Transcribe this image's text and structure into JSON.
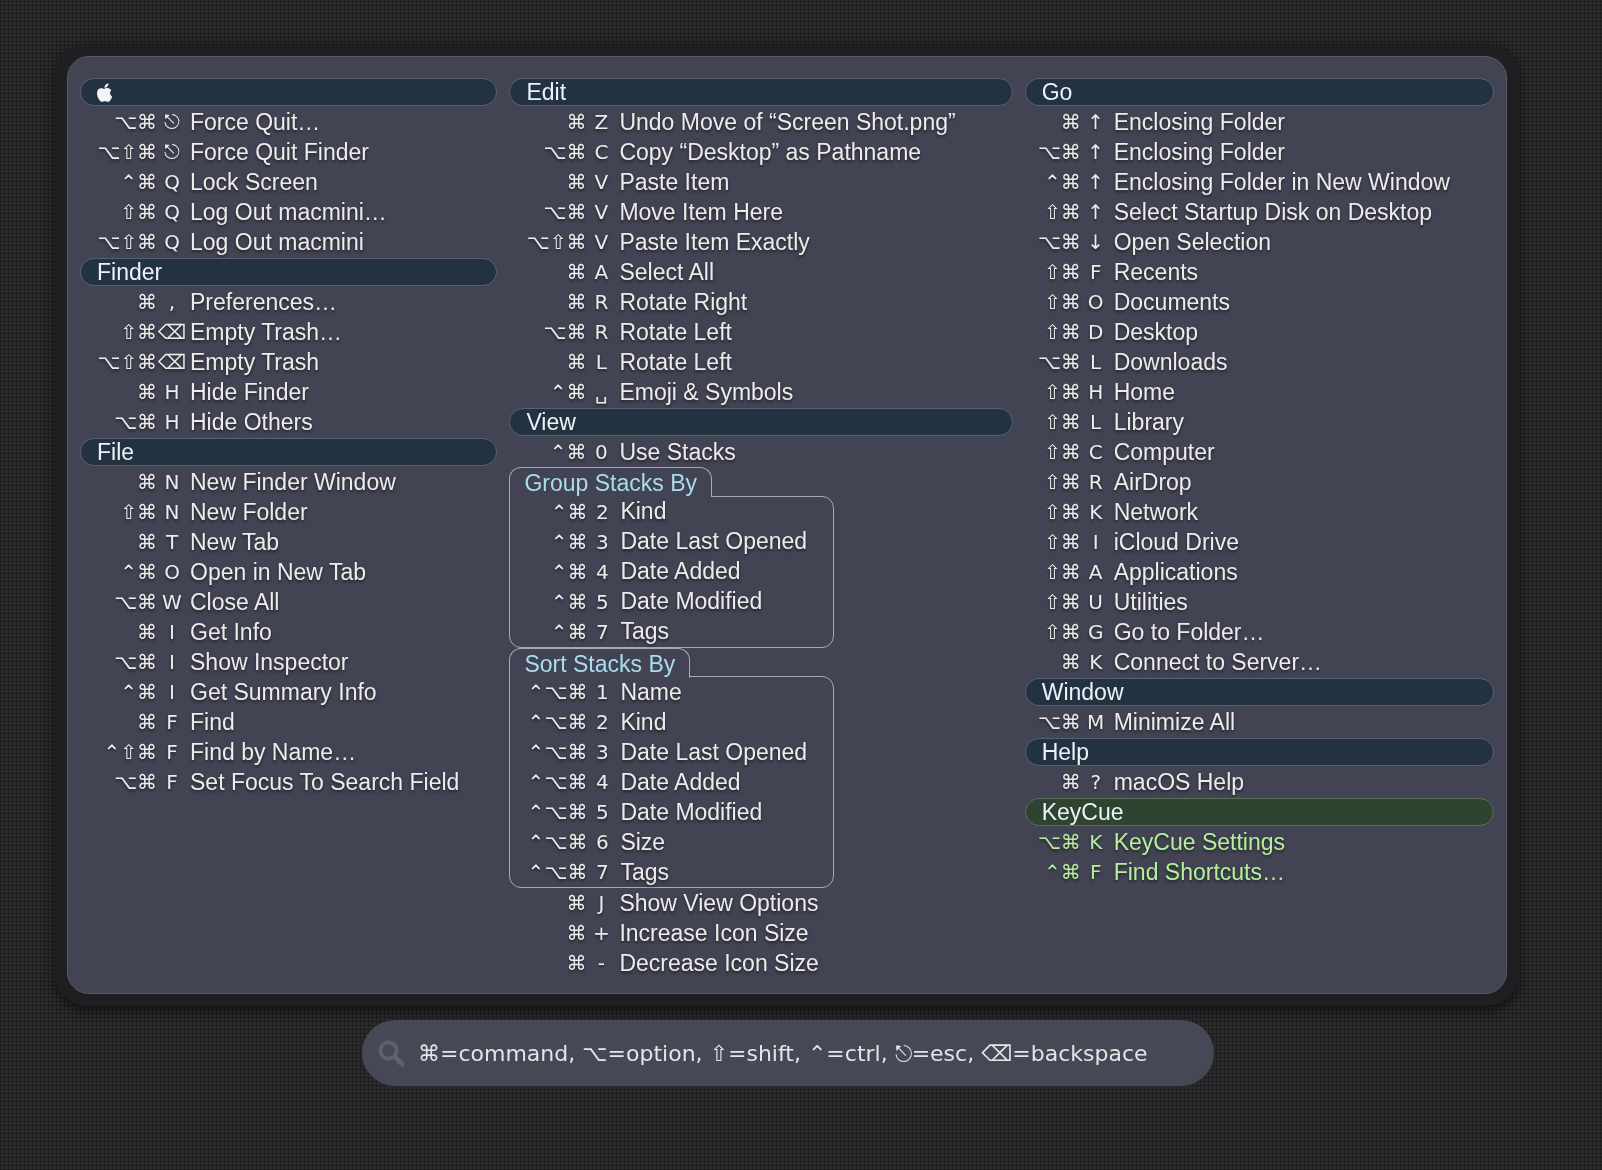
{
  "columns": [
    {
      "sections": [
        {
          "kind": "apple",
          "highlighted": false,
          "items": [
            {
              "kind": "shortcut",
              "mods": "⌥⌘",
              "key": "⎋",
              "label": "Force Quit…"
            },
            {
              "kind": "shortcut",
              "mods": "⌥⇧⌘",
              "key": "⎋",
              "label": "Force Quit Finder"
            },
            {
              "kind": "shortcut",
              "mods": "⌃⌘",
              "key": "Q",
              "label": "Lock Screen"
            },
            {
              "kind": "shortcut",
              "mods": "⇧⌘",
              "key": "Q",
              "label": "Log Out macmini…"
            },
            {
              "kind": "shortcut",
              "mods": "⌥⇧⌘",
              "key": "Q",
              "label": "Log Out macmini"
            }
          ]
        },
        {
          "kind": "menu",
          "title": "Finder",
          "highlighted": false,
          "items": [
            {
              "kind": "shortcut",
              "mods": "⌘",
              "key": ",",
              "label": "Preferences…"
            },
            {
              "kind": "shortcut",
              "mods": "⇧⌘",
              "key": "⌫",
              "label": "Empty Trash…"
            },
            {
              "kind": "shortcut",
              "mods": "⌥⇧⌘",
              "key": "⌫",
              "label": "Empty Trash"
            },
            {
              "kind": "shortcut",
              "mods": "⌘",
              "key": "H",
              "label": "Hide Finder"
            },
            {
              "kind": "shortcut",
              "mods": "⌥⌘",
              "key": "H",
              "label": "Hide Others"
            }
          ]
        },
        {
          "kind": "menu",
          "title": "File",
          "highlighted": false,
          "items": [
            {
              "kind": "shortcut",
              "mods": "⌘",
              "key": "N",
              "label": "New Finder Window"
            },
            {
              "kind": "shortcut",
              "mods": "⇧⌘",
              "key": "N",
              "label": "New Folder"
            },
            {
              "kind": "shortcut",
              "mods": "⌘",
              "key": "T",
              "label": "New Tab"
            },
            {
              "kind": "shortcut",
              "mods": "⌃⌘",
              "key": "O",
              "label": "Open in New Tab"
            },
            {
              "kind": "shortcut",
              "mods": "⌥⌘",
              "key": "W",
              "label": "Close All"
            },
            {
              "kind": "shortcut",
              "mods": "⌘",
              "key": "I",
              "label": "Get Info"
            },
            {
              "kind": "shortcut",
              "mods": "⌥⌘",
              "key": "I",
              "label": "Show Inspector"
            },
            {
              "kind": "shortcut",
              "mods": "⌃⌘",
              "key": "I",
              "label": "Get Summary Info"
            },
            {
              "kind": "shortcut",
              "mods": "⌘",
              "key": "F",
              "label": "Find"
            },
            {
              "kind": "shortcut",
              "mods": "⌃⇧⌘",
              "key": "F",
              "label": "Find by Name…"
            },
            {
              "kind": "shortcut",
              "mods": "⌥⌘",
              "key": "F",
              "label": "Set Focus To Search Field"
            }
          ]
        }
      ]
    },
    {
      "sections": [
        {
          "kind": "menu",
          "title": "Edit",
          "highlighted": false,
          "items": [
            {
              "kind": "shortcut",
              "mods": "⌘",
              "key": "Z",
              "label": "Undo Move of “Screen Shot.png”"
            },
            {
              "kind": "shortcut",
              "mods": "⌥⌘",
              "key": "C",
              "label": "Copy “Desktop” as Pathname"
            },
            {
              "kind": "shortcut",
              "mods": "⌘",
              "key": "V",
              "label": "Paste Item"
            },
            {
              "kind": "shortcut",
              "mods": "⌥⌘",
              "key": "V",
              "label": "Move Item Here"
            },
            {
              "kind": "shortcut",
              "mods": "⌥⇧⌘",
              "key": "V",
              "label": "Paste Item Exactly"
            },
            {
              "kind": "shortcut",
              "mods": "⌘",
              "key": "A",
              "label": "Select All"
            },
            {
              "kind": "shortcut",
              "mods": "⌘",
              "key": "R",
              "label": "Rotate Right"
            },
            {
              "kind": "shortcut",
              "mods": "⌥⌘",
              "key": "R",
              "label": "Rotate Left"
            },
            {
              "kind": "shortcut",
              "mods": "⌘",
              "key": "L",
              "label": "Rotate Left"
            },
            {
              "kind": "shortcut",
              "mods": "⌃⌘",
              "key": "␣",
              "label": "Emoji & Symbols"
            }
          ]
        },
        {
          "kind": "menu",
          "title": "View",
          "highlighted": false,
          "items": [
            {
              "kind": "shortcut",
              "mods": "⌃⌘",
              "key": "0",
              "label": "Use Stacks"
            },
            {
              "kind": "group",
              "title": "Group Stacks By",
              "items": [
                {
                  "kind": "shortcut",
                  "mods": "⌃⌘",
                  "key": "2",
                  "label": "Kind"
                },
                {
                  "kind": "shortcut",
                  "mods": "⌃⌘",
                  "key": "3",
                  "label": "Date Last Opened"
                },
                {
                  "kind": "shortcut",
                  "mods": "⌃⌘",
                  "key": "4",
                  "label": "Date Added"
                },
                {
                  "kind": "shortcut",
                  "mods": "⌃⌘",
                  "key": "5",
                  "label": "Date Modified"
                },
                {
                  "kind": "shortcut",
                  "mods": "⌃⌘",
                  "key": "7",
                  "label": "Tags"
                }
              ]
            },
            {
              "kind": "group",
              "title": "Sort Stacks By",
              "items": [
                {
                  "kind": "shortcut",
                  "mods": "⌃⌥⌘",
                  "key": "1",
                  "label": "Name"
                },
                {
                  "kind": "shortcut",
                  "mods": "⌃⌥⌘",
                  "key": "2",
                  "label": "Kind"
                },
                {
                  "kind": "shortcut",
                  "mods": "⌃⌥⌘",
                  "key": "3",
                  "label": "Date Last Opened"
                },
                {
                  "kind": "shortcut",
                  "mods": "⌃⌥⌘",
                  "key": "4",
                  "label": "Date Added"
                },
                {
                  "kind": "shortcut",
                  "mods": "⌃⌥⌘",
                  "key": "5",
                  "label": "Date Modified"
                },
                {
                  "kind": "shortcut",
                  "mods": "⌃⌥⌘",
                  "key": "6",
                  "label": "Size"
                },
                {
                  "kind": "shortcut",
                  "mods": "⌃⌥⌘",
                  "key": "7",
                  "label": "Tags"
                }
              ]
            },
            {
              "kind": "shortcut",
              "mods": "⌘",
              "key": "J",
              "label": "Show View Options"
            },
            {
              "kind": "shortcut",
              "mods": "⌘",
              "key": "+",
              "label": "Increase Icon Size"
            },
            {
              "kind": "shortcut",
              "mods": "⌘",
              "key": "-",
              "label": "Decrease Icon Size"
            }
          ]
        }
      ]
    },
    {
      "sections": [
        {
          "kind": "menu",
          "title": "Go",
          "highlighted": false,
          "items": [
            {
              "kind": "shortcut",
              "mods": "⌘",
              "key": "↑",
              "label": "Enclosing Folder"
            },
            {
              "kind": "shortcut",
              "mods": "⌥⌘",
              "key": "↑",
              "label": "Enclosing Folder"
            },
            {
              "kind": "shortcut",
              "mods": "⌃⌘",
              "key": "↑",
              "label": "Enclosing Folder in New Window"
            },
            {
              "kind": "shortcut",
              "mods": "⇧⌘",
              "key": "↑",
              "label": "Select Startup Disk on Desktop"
            },
            {
              "kind": "shortcut",
              "mods": "⌥⌘",
              "key": "↓",
              "label": "Open Selection"
            },
            {
              "kind": "shortcut",
              "mods": "⇧⌘",
              "key": "F",
              "label": "Recents"
            },
            {
              "kind": "shortcut",
              "mods": "⇧⌘",
              "key": "O",
              "label": "Documents"
            },
            {
              "kind": "shortcut",
              "mods": "⇧⌘",
              "key": "D",
              "label": "Desktop"
            },
            {
              "kind": "shortcut",
              "mods": "⌥⌘",
              "key": "L",
              "label": "Downloads"
            },
            {
              "kind": "shortcut",
              "mods": "⇧⌘",
              "key": "H",
              "label": "Home"
            },
            {
              "kind": "shortcut",
              "mods": "⇧⌘",
              "key": "L",
              "label": "Library"
            },
            {
              "kind": "shortcut",
              "mods": "⇧⌘",
              "key": "C",
              "label": "Computer"
            },
            {
              "kind": "shortcut",
              "mods": "⇧⌘",
              "key": "R",
              "label": "AirDrop"
            },
            {
              "kind": "shortcut",
              "mods": "⇧⌘",
              "key": "K",
              "label": "Network"
            },
            {
              "kind": "shortcut",
              "mods": "⇧⌘",
              "key": "I",
              "label": "iCloud Drive"
            },
            {
              "kind": "shortcut",
              "mods": "⇧⌘",
              "key": "A",
              "label": "Applications"
            },
            {
              "kind": "shortcut",
              "mods": "⇧⌘",
              "key": "U",
              "label": "Utilities"
            },
            {
              "kind": "shortcut",
              "mods": "⇧⌘",
              "key": "G",
              "label": "Go to Folder…"
            },
            {
              "kind": "shortcut",
              "mods": "⌘",
              "key": "K",
              "label": "Connect to Server…"
            }
          ]
        },
        {
          "kind": "menu",
          "title": "Window",
          "highlighted": false,
          "items": [
            {
              "kind": "shortcut",
              "mods": "⌥⌘",
              "key": "M",
              "label": "Minimize All"
            }
          ]
        },
        {
          "kind": "menu",
          "title": "Help",
          "highlighted": false,
          "items": [
            {
              "kind": "shortcut",
              "mods": "⌘",
              "key": "?",
              "label": "macOS Help"
            }
          ]
        },
        {
          "kind": "menu",
          "title": "KeyCue",
          "highlighted": true,
          "items": [
            {
              "kind": "shortcut",
              "mods": "⌥⌘",
              "key": "K",
              "label": "KeyCue Settings"
            },
            {
              "kind": "shortcut",
              "mods": "⌃⌘",
              "key": "F",
              "label": "Find Shortcuts…"
            }
          ]
        }
      ]
    }
  ],
  "search": {
    "placeholder": "⌘=command, ⌥=option, ⇧=shift, ⌃=ctrl, ⎋=esc, ⌫=backspace"
  }
}
